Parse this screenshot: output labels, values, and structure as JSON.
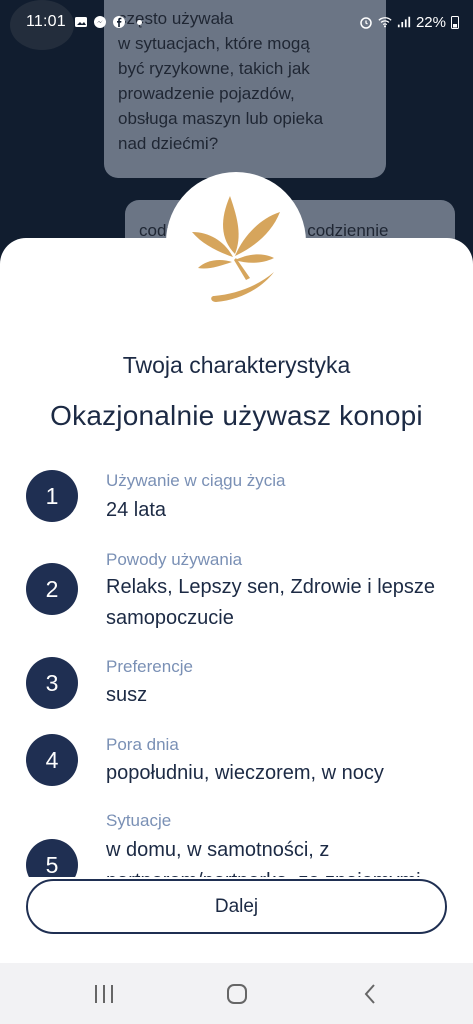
{
  "status_bar": {
    "time": "11:01",
    "battery": "22%",
    "icons_left": [
      "gallery-icon",
      "messenger-icon",
      "facebook-icon"
    ],
    "icons_right": [
      "alarm-icon",
      "wifi-icon",
      "volte-icon",
      "signal-icon",
      "battery-icon"
    ]
  },
  "chat": {
    "bubble1_lines": [
      "często używała",
      "w sytuacjach, które mogą",
      "być ryzykowne, takich jak",
      "prowadzenie pojazdów,",
      "obsługa maszyn lub opieka",
      "nad dziećmi?"
    ],
    "bubble2": "codziennie lub prawie codziennie"
  },
  "sheet": {
    "title": "Twoja charakterystyka",
    "heading": "Okazjonalnie używasz konopi",
    "items": [
      {
        "number": "1",
        "label": "Używanie w ciągu życia",
        "value": "24 lata"
      },
      {
        "number": "2",
        "label": "Powody używania",
        "value": "Relaks, Lepszy sen, Zdrowie i lepsze samopoczucie"
      },
      {
        "number": "3",
        "label": "Preferencje",
        "value": "susz"
      },
      {
        "number": "4",
        "label": "Pora dnia",
        "value": "popołudniu, wieczorem, w nocy"
      },
      {
        "number": "5",
        "label": "Sytuacje",
        "value": "w domu, w samotności, z partnerem/partnerką, ze znajomymi"
      }
    ],
    "next_button": "Dalej"
  },
  "colors": {
    "navy": "#1f2f52",
    "text": "#1c2a44",
    "label": "#7a90b5",
    "logo": "#d6a55c"
  }
}
